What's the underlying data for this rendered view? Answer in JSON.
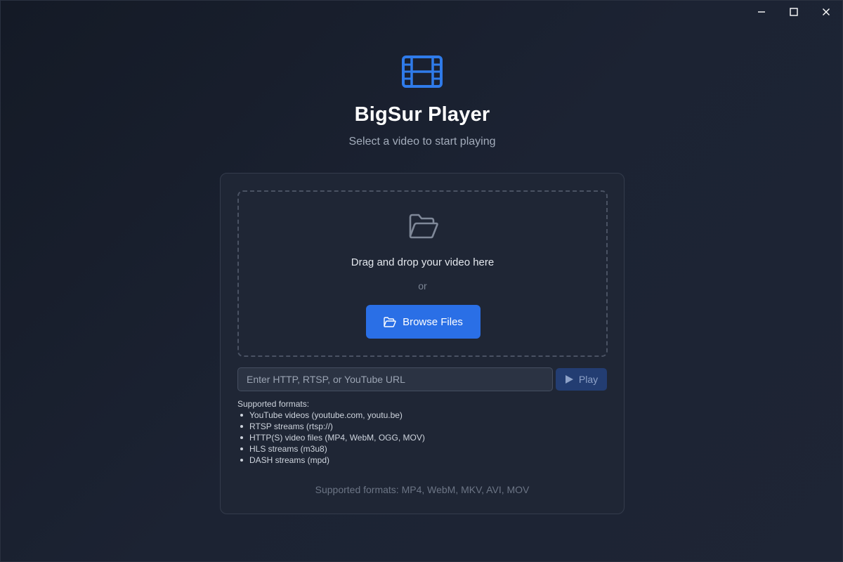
{
  "window": {
    "controls": [
      "minimize-icon",
      "maximize-icon",
      "close-icon"
    ]
  },
  "app": {
    "title": "BigSur Player",
    "subtitle": "Select a video to start playing",
    "logo_icon": "film-icon",
    "accent_color": "#2a6fe6"
  },
  "dropzone": {
    "icon": "folder-open-icon",
    "text": "Drag and drop your video here",
    "or_text": "or",
    "browse_label": "Browse Files"
  },
  "url_input": {
    "value": "",
    "placeholder": "Enter HTTP, RTSP, or YouTube URL"
  },
  "play_button": {
    "label": "Play",
    "icon": "play-icon"
  },
  "supported": {
    "heading": "Supported formats:",
    "items": [
      "YouTube videos (youtube.com, youtu.be)",
      "RTSP streams (rtsp://)",
      "HTTP(S) video files (MP4, WebM, OGG, MOV)",
      "HLS streams (m3u8)",
      "DASH streams (mpd)"
    ]
  },
  "footer": {
    "formats_text": "Supported formats: MP4, WebM, MKV, AVI, MOV"
  }
}
